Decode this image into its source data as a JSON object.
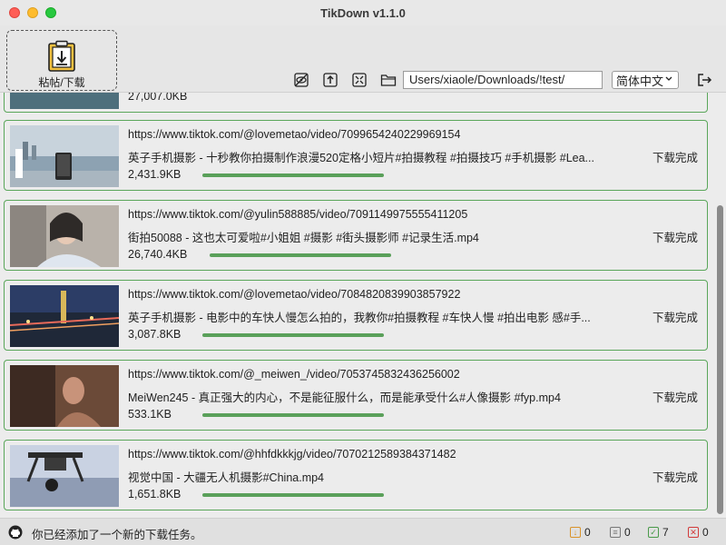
{
  "window": {
    "title": "TikDown v1.1.0"
  },
  "toolbar": {
    "paste_label": "粘帖/下载",
    "path_value": "Users/xiaole/Downloads/!test/",
    "language": "简体中文"
  },
  "partial_top": {
    "size": "27,007.0KB"
  },
  "items": [
    {
      "url": "https://www.tiktok.com/@lovemetao/video/7099654240229969154",
      "filename": "英子手机摄影 - 十秒教你拍摄制作浪漫520定格小短片#拍摄教程 #拍摄技巧 #手机摄影 #Lea...",
      "size": "2,431.9KB",
      "status": "下载完成",
      "progress": 1.0
    },
    {
      "url": "https://www.tiktok.com/@yulin588885/video/7091149975555411205",
      "filename": "街拍50088 - 这也太可爱啦#小姐姐 #摄影 #街头摄影师 #记录生活.mp4",
      "size": "26,740.4KB",
      "status": "下载完成",
      "progress": 1.0
    },
    {
      "url": "https://www.tiktok.com/@lovemetao/video/7084820839903857922",
      "filename": "英子手机摄影 - 电影中的车快人慢怎么拍的，我教你#拍摄教程 #车快人慢 #拍出电影 感#手...",
      "size": "3,087.8KB",
      "status": "下载完成",
      "progress": 1.0
    },
    {
      "url": "https://www.tiktok.com/@_meiwen_/video/7053745832436256002",
      "filename": "MeiWen245 - 真正强大的内心，不是能征服什么，而是能承受什么#人像摄影 #fyp.mp4",
      "size": "533.1KB",
      "status": "下载完成",
      "progress": 1.0
    },
    {
      "url": "https://www.tiktok.com/@hhfdkkkjg/video/7070212589384371482",
      "filename": "视觉中国 - 大疆无人机摄影#China.mp4",
      "size": "1,651.8KB",
      "status": "下载完成",
      "progress": 1.0
    }
  ],
  "statusbar": {
    "message": "你已经添加了一个新的下载任务。",
    "pending": "0",
    "queued": "0",
    "done": "7",
    "failed": "0"
  },
  "colors": {
    "accent_green": "#5aa65a",
    "progress_green": "#5aa05a",
    "pending_orange": "#d9932a",
    "failed_red": "#d23a3a"
  }
}
